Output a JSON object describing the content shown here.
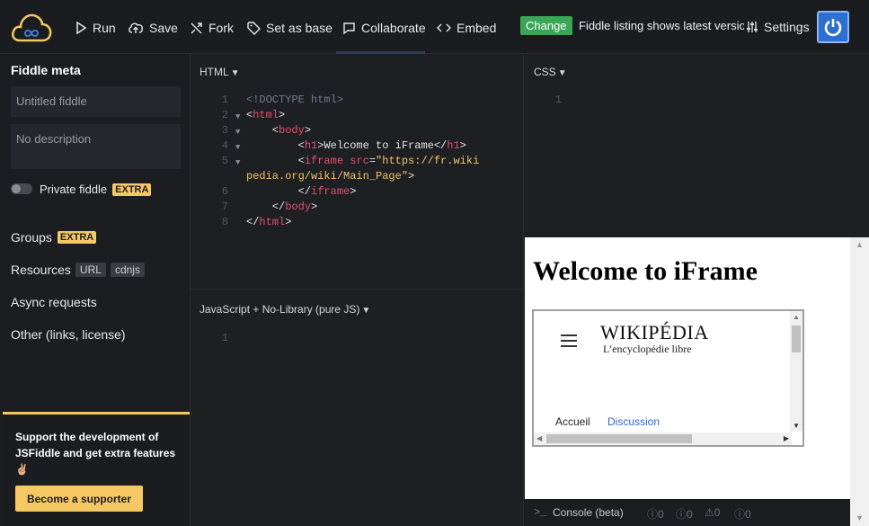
{
  "toolbar": {
    "run": "Run",
    "save": "Save",
    "fork": "Fork",
    "set_as_base": "Set as base",
    "collaborate": "Collaborate",
    "embed": "Embed",
    "change_badge": "Change",
    "notice": "Fiddle listing shows latest version",
    "settings": "Settings"
  },
  "sidebar": {
    "title": "Fiddle meta",
    "title_placeholder": "Untitled fiddle",
    "description_placeholder": "No description",
    "private_label": "Private fiddle",
    "extra_badge": "EXTRA",
    "groups": "Groups",
    "resources": "Resources",
    "resource_url": "URL",
    "resource_cdnjs": "cdnjs",
    "async": "Async requests",
    "other": "Other (links, license)",
    "support_text": "Support the development of JSFiddle and get extra features ✌🏼",
    "support_button": "Become a supporter"
  },
  "panels": {
    "html_label": "HTML",
    "css_label": "CSS",
    "js_label": "JavaScript + No-Library (pure JS)",
    "css_line": "1",
    "js_line": "1"
  },
  "html_code": {
    "line_numbers": [
      "1",
      "2",
      "3",
      "4",
      "5",
      "6",
      "7",
      "8"
    ],
    "l1": "<!DOCTYPE html>",
    "l2_open": "<",
    "l2_tag": "html",
    "l2_close": ">",
    "l3_tag": "body",
    "l4_tag": "h1",
    "l4_text": "Welcome to iFrame",
    "l5_tag": "iframe",
    "l5_attr": "src",
    "l5_val1": "\"https://fr.wiki",
    "l5_val2": "pedia.org/wiki/Main_Page\"",
    "l6_tag": "iframe",
    "l7_tag": "body",
    "l8_tag": "html"
  },
  "result": {
    "heading": "Welcome to iFrame",
    "wiki_title": "WIKIPÉDIA",
    "wiki_subtitle": "L’encyclopédie libre",
    "tab_home": "Accueil",
    "tab_discussion": "Discussion"
  },
  "console": {
    "label": "Console (beta)",
    "counts": [
      "0",
      "0",
      "0",
      "0"
    ]
  }
}
